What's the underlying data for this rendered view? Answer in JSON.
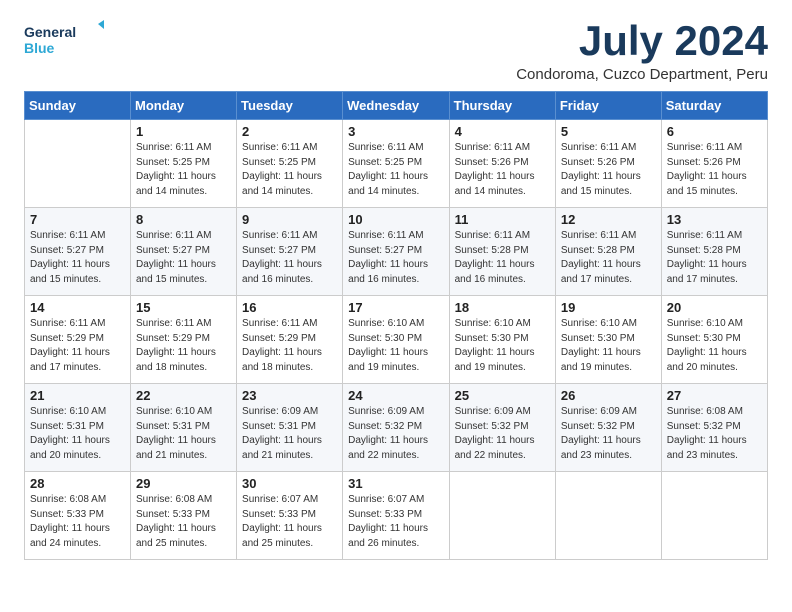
{
  "logo": {
    "line1": "General",
    "line2": "Blue"
  },
  "title": "July 2024",
  "subtitle": "Condoroma, Cuzco Department, Peru",
  "days_header": [
    "Sunday",
    "Monday",
    "Tuesday",
    "Wednesday",
    "Thursday",
    "Friday",
    "Saturday"
  ],
  "weeks": [
    [
      {
        "day": "",
        "sunrise": "",
        "sunset": "",
        "daylight": ""
      },
      {
        "day": "1",
        "sunrise": "6:11 AM",
        "sunset": "5:25 PM",
        "daylight": "11 hours and 14 minutes."
      },
      {
        "day": "2",
        "sunrise": "6:11 AM",
        "sunset": "5:25 PM",
        "daylight": "11 hours and 14 minutes."
      },
      {
        "day": "3",
        "sunrise": "6:11 AM",
        "sunset": "5:25 PM",
        "daylight": "11 hours and 14 minutes."
      },
      {
        "day": "4",
        "sunrise": "6:11 AM",
        "sunset": "5:26 PM",
        "daylight": "11 hours and 14 minutes."
      },
      {
        "day": "5",
        "sunrise": "6:11 AM",
        "sunset": "5:26 PM",
        "daylight": "11 hours and 15 minutes."
      },
      {
        "day": "6",
        "sunrise": "6:11 AM",
        "sunset": "5:26 PM",
        "daylight": "11 hours and 15 minutes."
      }
    ],
    [
      {
        "day": "7",
        "sunrise": "6:11 AM",
        "sunset": "5:27 PM",
        "daylight": "11 hours and 15 minutes."
      },
      {
        "day": "8",
        "sunrise": "6:11 AM",
        "sunset": "5:27 PM",
        "daylight": "11 hours and 15 minutes."
      },
      {
        "day": "9",
        "sunrise": "6:11 AM",
        "sunset": "5:27 PM",
        "daylight": "11 hours and 16 minutes."
      },
      {
        "day": "10",
        "sunrise": "6:11 AM",
        "sunset": "5:27 PM",
        "daylight": "11 hours and 16 minutes."
      },
      {
        "day": "11",
        "sunrise": "6:11 AM",
        "sunset": "5:28 PM",
        "daylight": "11 hours and 16 minutes."
      },
      {
        "day": "12",
        "sunrise": "6:11 AM",
        "sunset": "5:28 PM",
        "daylight": "11 hours and 17 minutes."
      },
      {
        "day": "13",
        "sunrise": "6:11 AM",
        "sunset": "5:28 PM",
        "daylight": "11 hours and 17 minutes."
      }
    ],
    [
      {
        "day": "14",
        "sunrise": "6:11 AM",
        "sunset": "5:29 PM",
        "daylight": "11 hours and 17 minutes."
      },
      {
        "day": "15",
        "sunrise": "6:11 AM",
        "sunset": "5:29 PM",
        "daylight": "11 hours and 18 minutes."
      },
      {
        "day": "16",
        "sunrise": "6:11 AM",
        "sunset": "5:29 PM",
        "daylight": "11 hours and 18 minutes."
      },
      {
        "day": "17",
        "sunrise": "6:10 AM",
        "sunset": "5:30 PM",
        "daylight": "11 hours and 19 minutes."
      },
      {
        "day": "18",
        "sunrise": "6:10 AM",
        "sunset": "5:30 PM",
        "daylight": "11 hours and 19 minutes."
      },
      {
        "day": "19",
        "sunrise": "6:10 AM",
        "sunset": "5:30 PM",
        "daylight": "11 hours and 19 minutes."
      },
      {
        "day": "20",
        "sunrise": "6:10 AM",
        "sunset": "5:30 PM",
        "daylight": "11 hours and 20 minutes."
      }
    ],
    [
      {
        "day": "21",
        "sunrise": "6:10 AM",
        "sunset": "5:31 PM",
        "daylight": "11 hours and 20 minutes."
      },
      {
        "day": "22",
        "sunrise": "6:10 AM",
        "sunset": "5:31 PM",
        "daylight": "11 hours and 21 minutes."
      },
      {
        "day": "23",
        "sunrise": "6:09 AM",
        "sunset": "5:31 PM",
        "daylight": "11 hours and 21 minutes."
      },
      {
        "day": "24",
        "sunrise": "6:09 AM",
        "sunset": "5:32 PM",
        "daylight": "11 hours and 22 minutes."
      },
      {
        "day": "25",
        "sunrise": "6:09 AM",
        "sunset": "5:32 PM",
        "daylight": "11 hours and 22 minutes."
      },
      {
        "day": "26",
        "sunrise": "6:09 AM",
        "sunset": "5:32 PM",
        "daylight": "11 hours and 23 minutes."
      },
      {
        "day": "27",
        "sunrise": "6:08 AM",
        "sunset": "5:32 PM",
        "daylight": "11 hours and 23 minutes."
      }
    ],
    [
      {
        "day": "28",
        "sunrise": "6:08 AM",
        "sunset": "5:33 PM",
        "daylight": "11 hours and 24 minutes."
      },
      {
        "day": "29",
        "sunrise": "6:08 AM",
        "sunset": "5:33 PM",
        "daylight": "11 hours and 25 minutes."
      },
      {
        "day": "30",
        "sunrise": "6:07 AM",
        "sunset": "5:33 PM",
        "daylight": "11 hours and 25 minutes."
      },
      {
        "day": "31",
        "sunrise": "6:07 AM",
        "sunset": "5:33 PM",
        "daylight": "11 hours and 26 minutes."
      },
      {
        "day": "",
        "sunrise": "",
        "sunset": "",
        "daylight": ""
      },
      {
        "day": "",
        "sunrise": "",
        "sunset": "",
        "daylight": ""
      },
      {
        "day": "",
        "sunrise": "",
        "sunset": "",
        "daylight": ""
      }
    ]
  ],
  "labels": {
    "sunrise_prefix": "Sunrise: ",
    "sunset_prefix": "Sunset: ",
    "daylight_prefix": "Daylight: "
  }
}
